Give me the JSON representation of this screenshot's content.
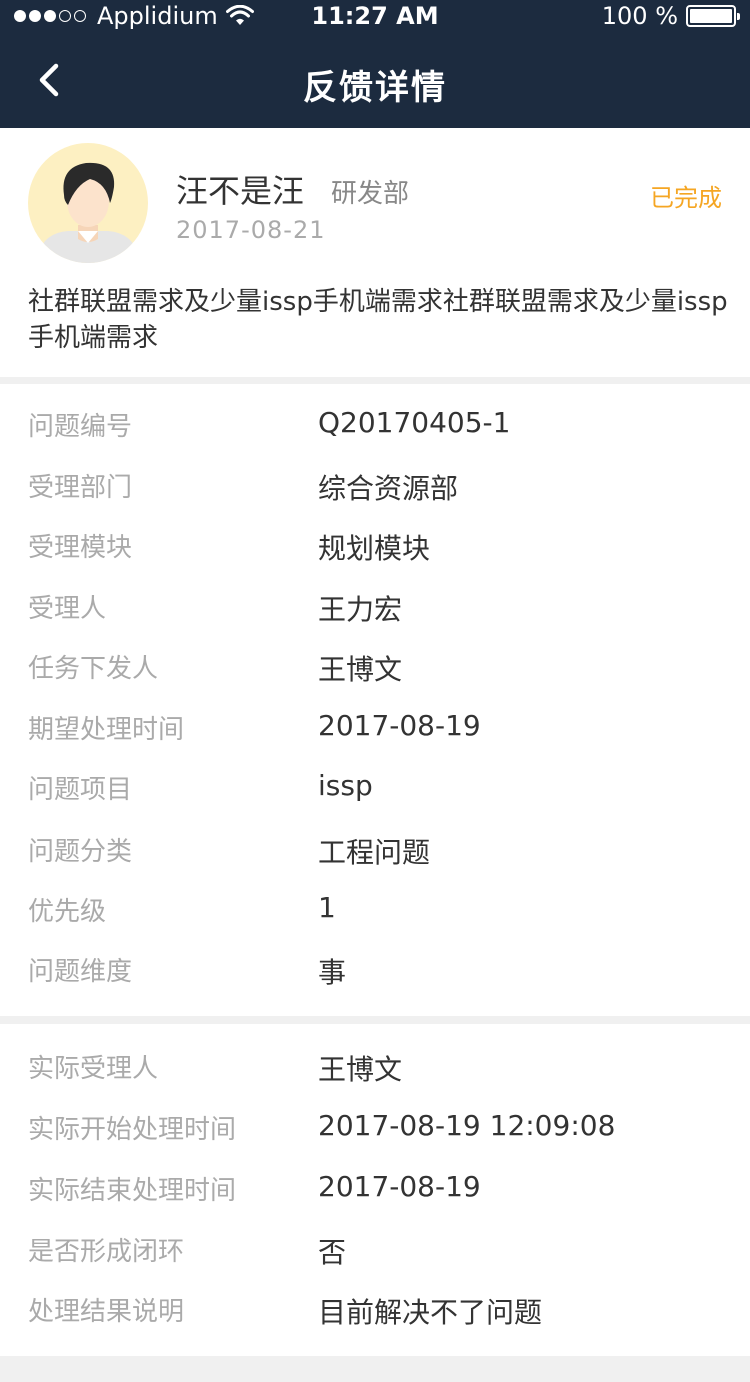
{
  "status_bar": {
    "carrier": "Applidium",
    "time": "11:27 AM",
    "battery": "100 %"
  },
  "nav": {
    "title": "反馈详情",
    "back_icon": "chevron-left-icon"
  },
  "feedback": {
    "user_name": "汪不是汪",
    "department": "研发部",
    "date": "2017-08-21",
    "status": "已完成",
    "status_color": "#f5a623",
    "description": "社群联盟需求及少量issp手机端需求社群联盟需求及少量issp手机端需求"
  },
  "details": [
    {
      "label": "问题编号",
      "value": "Q20170405-1"
    },
    {
      "label": "受理部门",
      "value": "综合资源部"
    },
    {
      "label": "受理模块",
      "value": "规划模块"
    },
    {
      "label": "受理人",
      "value": "王力宏"
    },
    {
      "label": "任务下发人",
      "value": "王博文"
    },
    {
      "label": "期望处理时间",
      "value": "2017-08-19"
    },
    {
      "label": "问题项目",
      "value": "issp"
    },
    {
      "label": "问题分类",
      "value": "工程问题"
    },
    {
      "label": "优先级",
      "value": "1"
    },
    {
      "label": "问题维度",
      "value": "事"
    }
  ],
  "processing": [
    {
      "label": "实际受理人",
      "value": "王博文"
    },
    {
      "label": "实际开始处理时间",
      "value": "2017-08-19 12:09:08"
    },
    {
      "label": "实际结束处理时间",
      "value": "2017-08-19"
    },
    {
      "label": "是否形成闭环",
      "value": "否"
    },
    {
      "label": "处理结果说明",
      "value": "目前解决不了问题"
    }
  ],
  "colors": {
    "nav_bg": "#1c2b3f",
    "label": "#aaaaaa",
    "value": "#333333",
    "background": "#f0f0f0"
  }
}
